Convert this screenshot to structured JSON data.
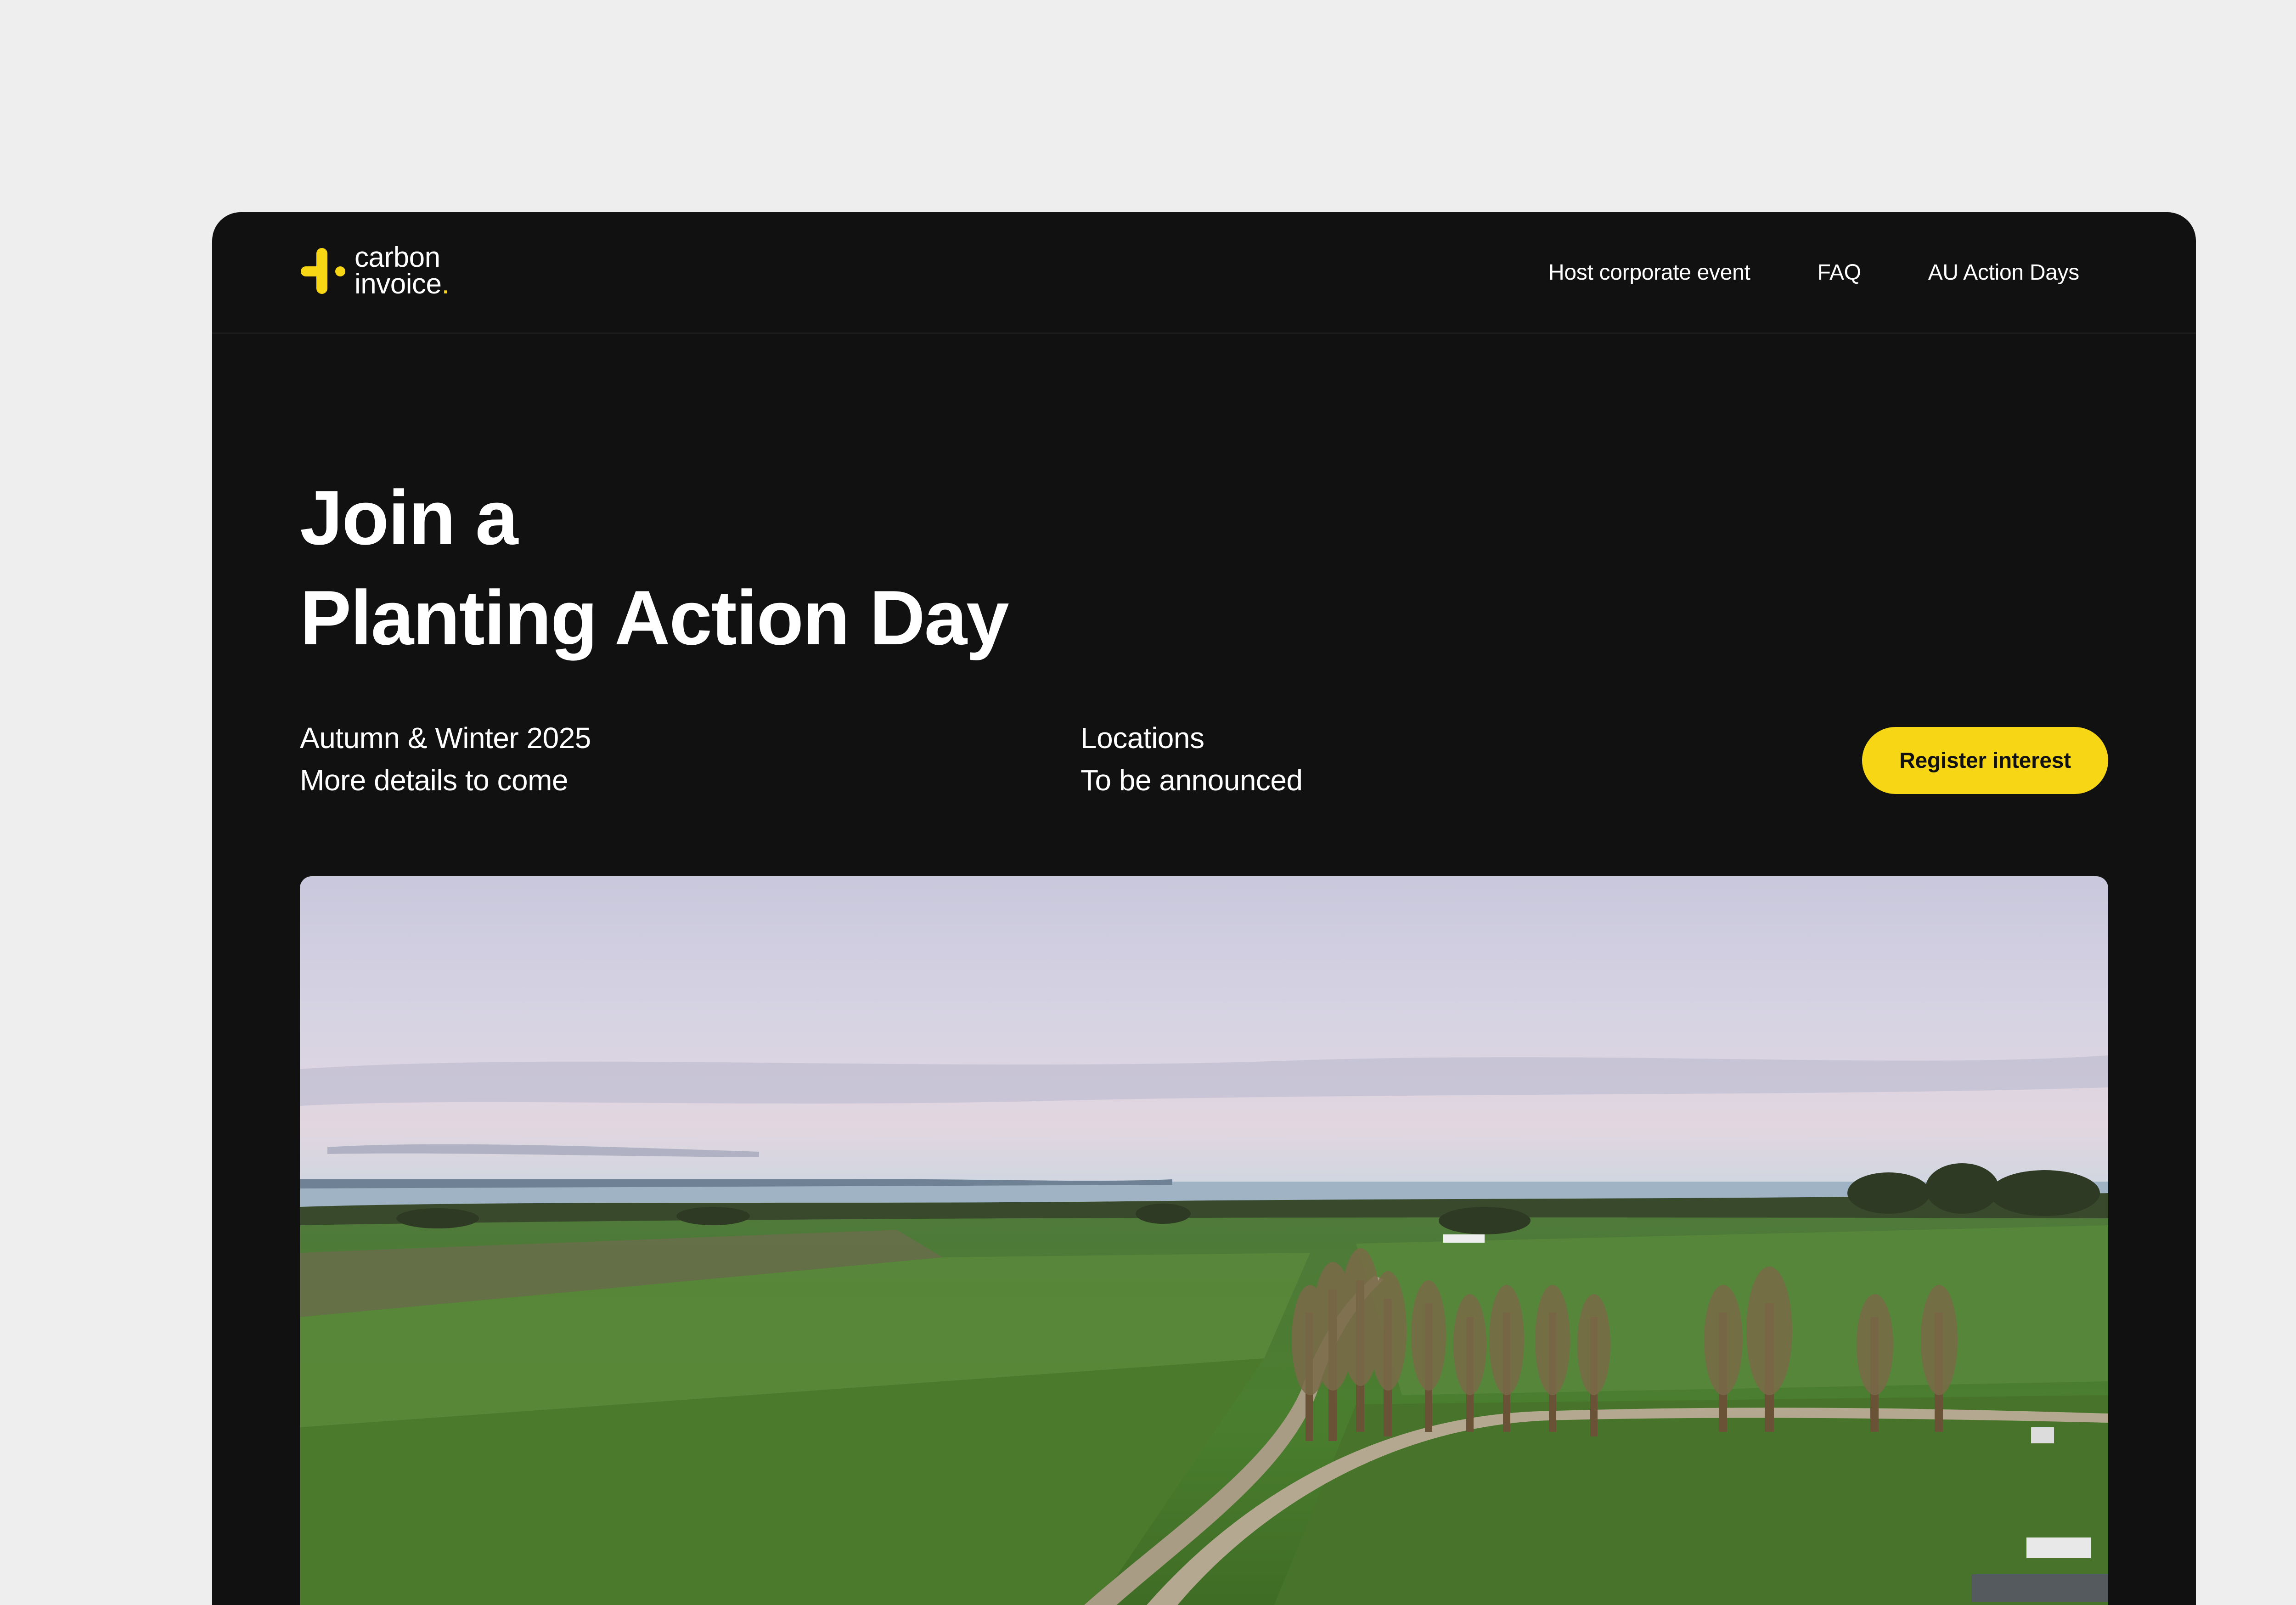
{
  "brand": {
    "line1": "carbon",
    "line2": "invoice",
    "dot": ".",
    "accent_color": "#f7d715",
    "icon": "plus-logo-icon"
  },
  "nav": {
    "links": [
      {
        "label": "Host corporate event"
      },
      {
        "label": "FAQ"
      },
      {
        "label": "AU Action Days"
      }
    ]
  },
  "hero": {
    "title_line1": "Join a",
    "title_line2": "Planting Action Day",
    "dates_line1": "Autumn & Winter 2025",
    "dates_line2": "More details to come",
    "locations_line1": "Locations",
    "locations_line2": "To be announced",
    "register_label": "Register interest",
    "image_subject": "aerial-farmland-photo"
  },
  "colors": {
    "background": "#111112",
    "page": "#eeeeee",
    "button": "#f7d715"
  }
}
